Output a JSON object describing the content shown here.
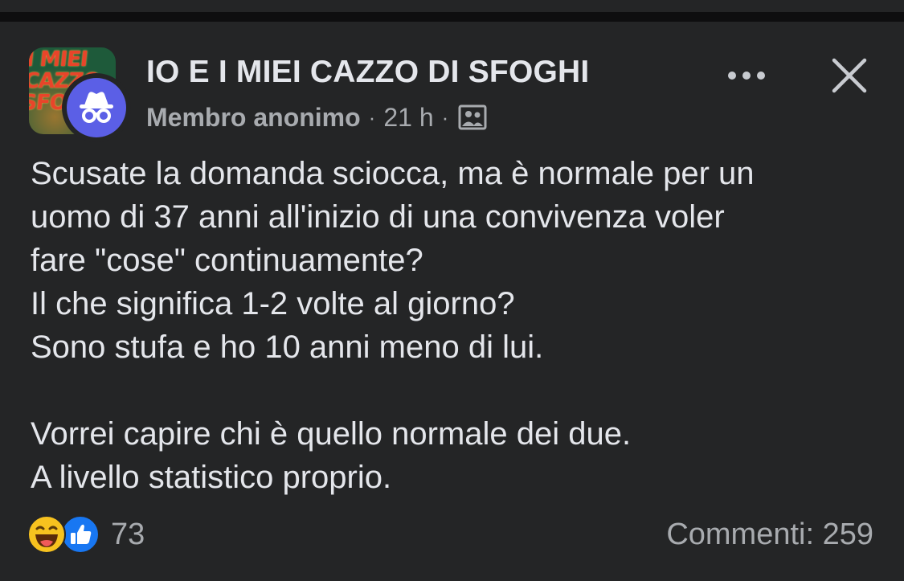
{
  "header": {
    "group_name": "IO E I MIEI CAZZO DI SFOGHI",
    "group_avatar_text": "I MIEI CAZZO DI SFOGHI",
    "author": "Membro anonimo",
    "separator": "·",
    "time_ago": "21 h",
    "audience_icon": "group-audience-icon",
    "more_icon": "more-options-icon",
    "close_icon": "close-icon"
  },
  "post": {
    "lines": [
      "Scusate la domanda sciocca, ma è normale per un",
      "uomo di 37 anni all'inizio di una convivenza voler",
      "fare \"cose\" continuamente?",
      "Il che significa 1-2 volte al giorno?",
      "Sono stufa e ho 10 anni meno di lui."
    ],
    "lines_2": [
      "Vorrei capire chi è quello normale dei due.",
      "A livello statistico proprio."
    ]
  },
  "footer": {
    "reaction_icons": [
      "haha-reaction-icon",
      "like-reaction-icon"
    ],
    "reaction_count": "73",
    "comments": "Commenti: 259"
  },
  "colors": {
    "background": "#242526",
    "text": "#e4e6eb",
    "secondary_text": "#a8abaf",
    "anon_badge": "#5b5fe6",
    "like_blue": "#1877f2",
    "haha_yellow": "#f7c21f"
  }
}
